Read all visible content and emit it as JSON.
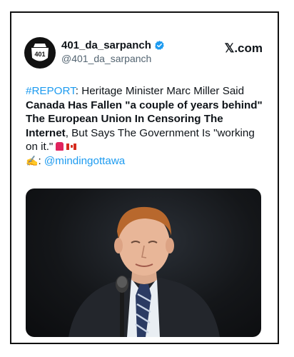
{
  "tweet": {
    "display_name": "401_da_sarpanch",
    "handle": "@401_da_sarpanch",
    "source": "𝕏.com",
    "avatar_text": "401",
    "text_parts": {
      "hashtag": "#REPORT",
      "after_hashtag": ": Heritage Minister Marc Miller Said ",
      "bold_1": "Canada Has Fallen \"a couple of years behind\" The European Union In Censoring The Internet",
      "after_bold": ", But Says The Government Is \"working on it.\"",
      "credit_prefix": ": ",
      "mention": "@mindingottawa"
    },
    "colors": {
      "link": "#1d9bf0",
      "verified": "#1d9bf0",
      "text": "#0f1419",
      "muted": "#536471"
    },
    "icons": [
      "verified-badge-icon",
      "siren-emoji",
      "canada-flag-emoji",
      "writing-hand-emoji"
    ],
    "image_alt": "Heritage Minister Marc Miller speaking at a microphone"
  }
}
